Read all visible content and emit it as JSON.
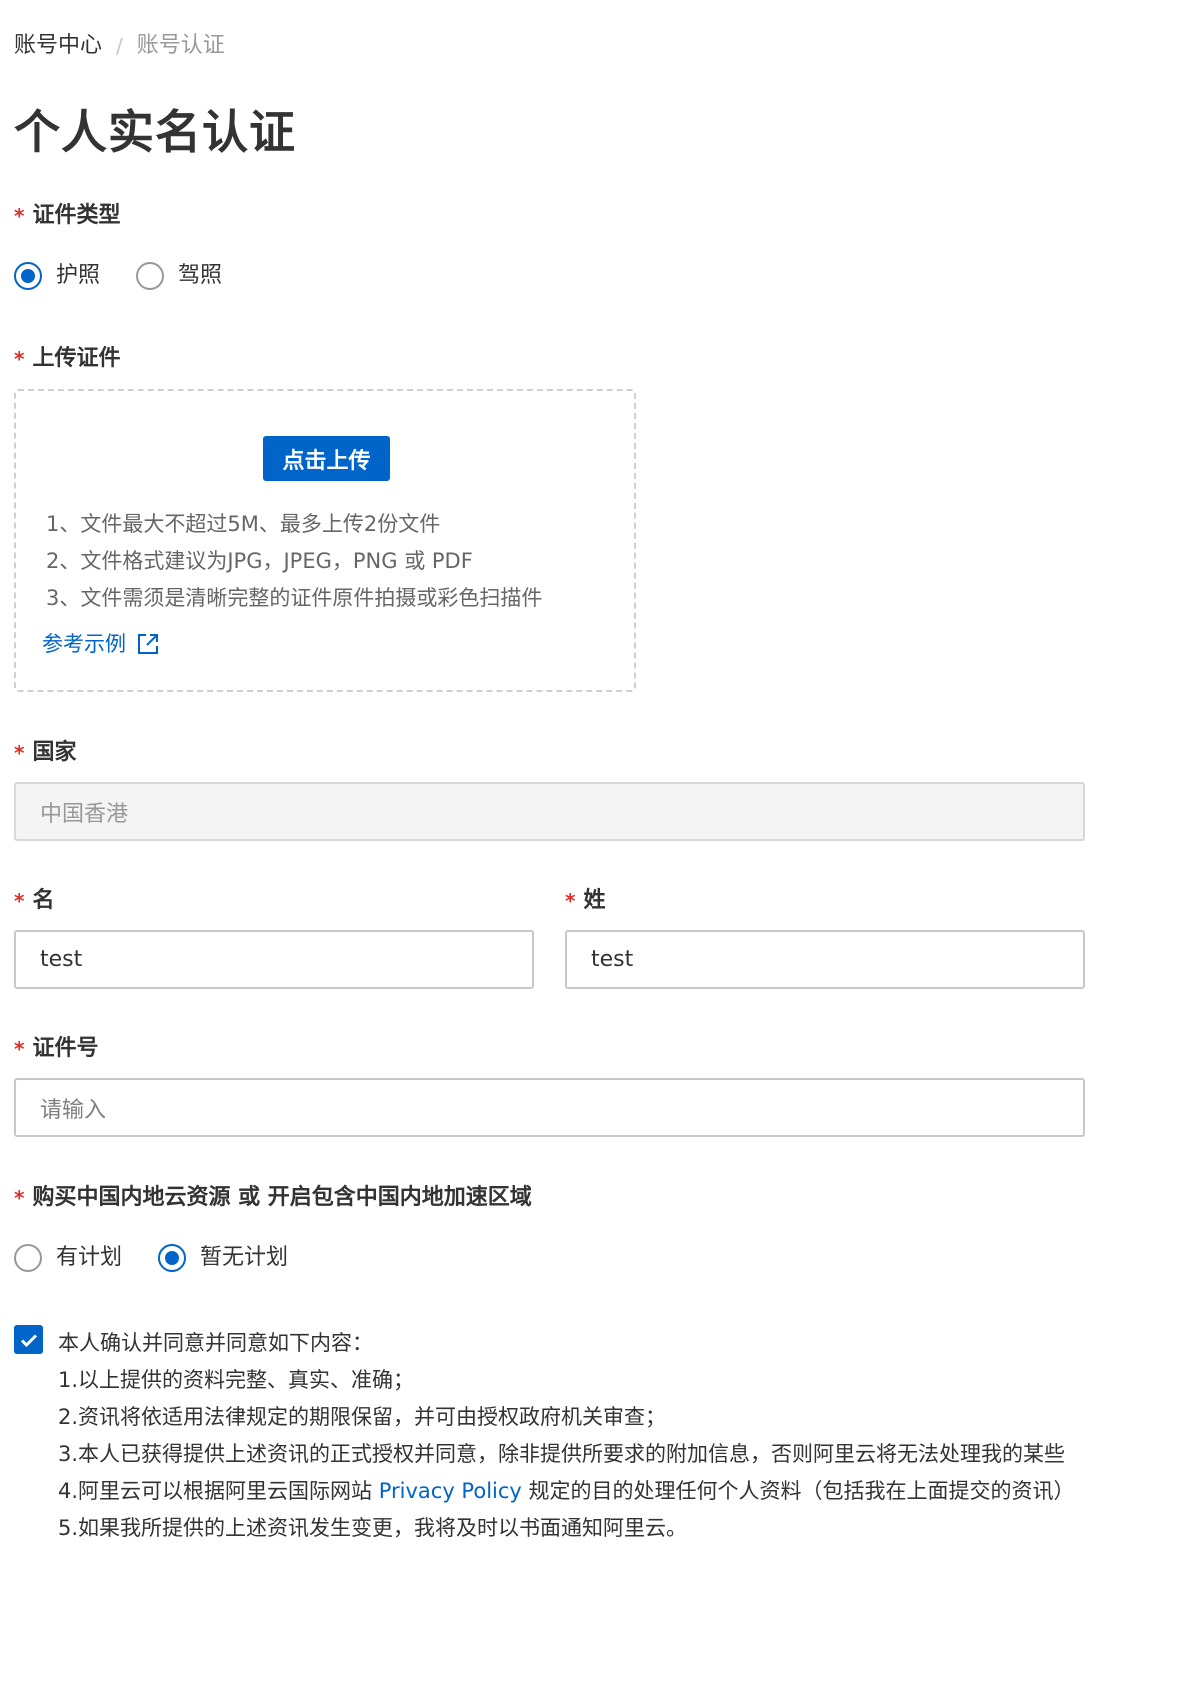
{
  "breadcrumb": {
    "parent": "账号中心",
    "separator": "/",
    "current": "账号认证"
  },
  "page_title": "个人实名认证",
  "required_mark": "*",
  "doc_type": {
    "label": "证件类型",
    "options": [
      {
        "label": "护照",
        "checked": true
      },
      {
        "label": "驾照",
        "checked": false
      }
    ]
  },
  "upload": {
    "label": "上传证件",
    "button": "点击上传",
    "rules": [
      "1、文件最大不超过5M、最多上传2份文件",
      "2、文件格式建议为JPG，JPEG，PNG 或 PDF",
      "3、文件需须是清晰完整的证件原件拍摄或彩色扫描件"
    ],
    "reference_link": "参考示例"
  },
  "country": {
    "label": "国家",
    "value": "中国香港"
  },
  "first_name": {
    "label": "名",
    "value": "test"
  },
  "last_name": {
    "label": "姓",
    "value": "test"
  },
  "id_number": {
    "label": "证件号",
    "placeholder": "请输入"
  },
  "mainland": {
    "label": "购买中国内地云资源 或 开启包含中国内地加速区域",
    "options": [
      {
        "label": "有计划",
        "checked": false
      },
      {
        "label": "暂无计划",
        "checked": true
      }
    ]
  },
  "agreement": {
    "checked": true,
    "intro": "本人确认并同意并同意如下内容：",
    "item1": "1.以上提供的资料完整、真实、准确；",
    "item2": "2.资讯将依适用法律规定的期限保留，并可由授权政府机关审查；",
    "item3": "3.本人已获得提供上述资讯的正式授权并同意，除非提供所要求的附加信息，否则阿里云将无法处理我的某些",
    "item4_pre": "4.阿里云可以根据阿里云国际网站 ",
    "item4_link": "Privacy Policy",
    "item4_post": " 规定的目的处理任何个人资料（包括我在上面提交的资讯）",
    "item5": "5.如果我所提供的上述资讯发生变更，我将及时以书面通知阿里云。"
  },
  "colors": {
    "primary": "#0064c8",
    "required": "#d93026",
    "text": "#333333",
    "muted": "#999999"
  }
}
